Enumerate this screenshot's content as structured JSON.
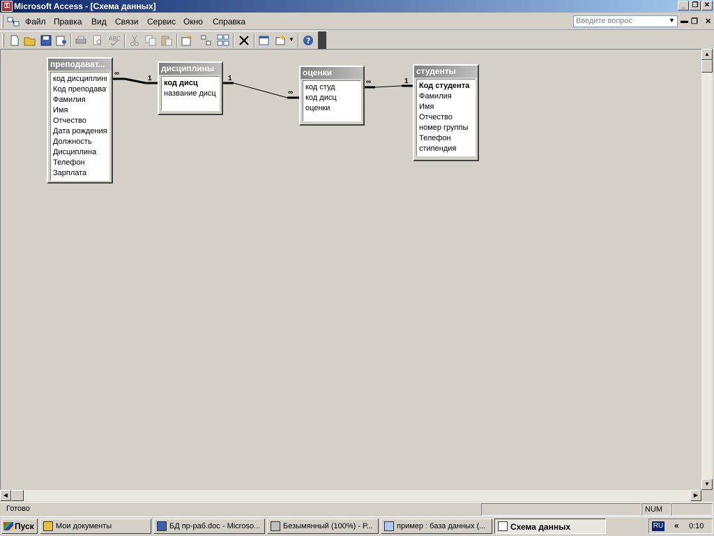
{
  "window": {
    "title": "Microsoft Access - [Схема данных]",
    "minimize": "_",
    "restore": "❐",
    "close": "✕"
  },
  "menu": {
    "items": [
      "Файл",
      "Правка",
      "Вид",
      "Связи",
      "Сервис",
      "Окно",
      "Справка"
    ],
    "help_placeholder": "Введите вопрос"
  },
  "tables": {
    "teachers": {
      "name": "преподават...",
      "fields": [
        "код дисциплинь",
        "Код преподават",
        "Фамилия",
        "Имя",
        "Отчество",
        "Дата рождения",
        "Должность",
        "Дисциплина",
        "Телефон",
        "Зарплата"
      ]
    },
    "disciplines": {
      "name": "дисциплины",
      "fields": [
        "код дисц",
        "название дисц"
      ],
      "key": "код дисц"
    },
    "grades": {
      "name": "оценки",
      "fields": [
        "код студ",
        "код дисц",
        "оценки"
      ]
    },
    "students": {
      "name": "студенты",
      "fields": [
        "Код студента",
        "Фамилия",
        "Имя",
        "Отчество",
        "номер группы",
        "Телефон",
        "стипендия"
      ],
      "key": "Код студента"
    }
  },
  "relations": [
    {
      "from": "teachers",
      "to": "disciplines",
      "from_card": "∞",
      "to_card": "1"
    },
    {
      "from": "disciplines",
      "to": "grades",
      "from_card": "1",
      "to_card": "∞"
    },
    {
      "from": "grades",
      "to": "students",
      "from_card": "∞",
      "to_card": "1"
    }
  ],
  "status": {
    "text": "Готово",
    "num": "NUM"
  },
  "taskbar": {
    "start": "Пуск",
    "buttons": [
      {
        "label": "Мои документы"
      },
      {
        "label": "БД пр-раб.doc - Microso..."
      },
      {
        "label": "Безымянный (100%) - Р..."
      },
      {
        "label": "пример : база данных (..."
      },
      {
        "label": "Схема данных"
      }
    ],
    "lang": "RU",
    "tray_arrow": "«",
    "clock": "0:10"
  }
}
